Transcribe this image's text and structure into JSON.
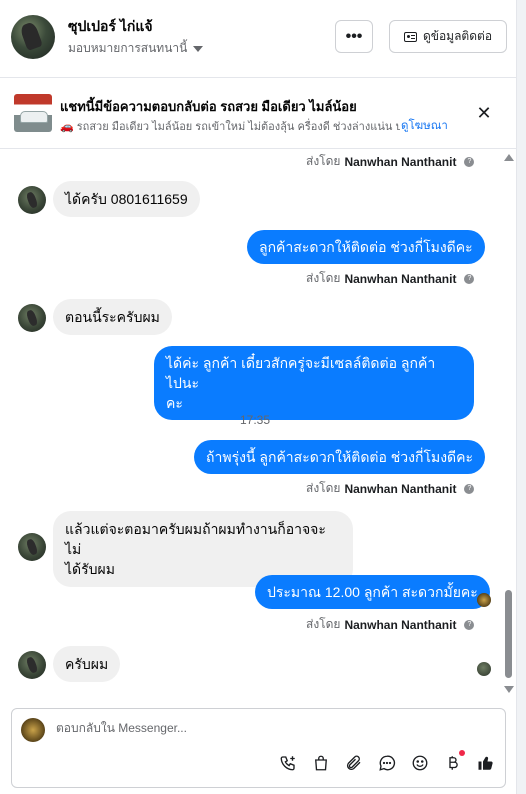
{
  "header": {
    "contact_name": "ซุปเปอร์ ไก่แจ้",
    "assign_label": "มอบหมายการสนทนานี้",
    "more_label": "•••",
    "contact_info_label": "ดูข้อมูลติดต่อ"
  },
  "banner": {
    "title": "แชทนี้มีข้อความตอบกลับต่อ รถสวย มือเดียว ไมล์น้อย",
    "subtitle": "🚗 รถสวย มือเดียว ไมล์น้อย รถเข้าใหม่ ไม่ต้องลุ้น ครื่องดี ช่วงล่างแน่น ประ...",
    "link": "ดูโฆษณา",
    "close": "✕"
  },
  "messages": {
    "sent_by_prefix": "ส่งโดย",
    "sender": "Nanwhan Nanthanit",
    "m1": "ได้ครับ 0801611659",
    "m2": "ลูกค้าสะดวกให้ติดต่อ ช่วงกี่โมงดีคะ",
    "m3": "ตอนนี้ระครับผม",
    "m4_line1": "ได้ค่ะ ลูกค้า เดี๋ยวสักครู่จะมีเซลล์ติดต่อ ลูกค้า ไปนะ",
    "m4_line2": "คะ",
    "time": "17:35",
    "m5": "ถ้าพรุ่งนี้ ลูกค้าสะดวกให้ติดต่อ ช่วงกี่โมงดีคะ",
    "m6_line1": "แล้วแต่จะตอมาครับผมถ้าผมทำงานก็อาจจะไม่",
    "m6_line2": "ได้รับผม",
    "m7": "ประมาณ 12.00 ลูกค้า สะดวกมั้ยคะ",
    "m8": "ครับผม"
  },
  "composer": {
    "placeholder": "ตอบกลับใน Messenger..."
  },
  "colors": {
    "outgoing_bubble": "#0a7cff",
    "incoming_bubble": "#f0f0f0",
    "link": "#1877f2"
  }
}
